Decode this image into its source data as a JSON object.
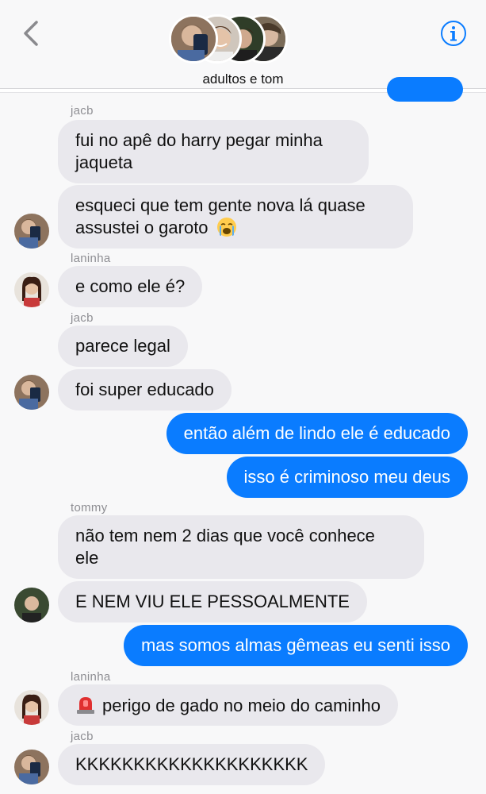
{
  "header": {
    "group_name": "adultos e tom",
    "back_icon": "chevron-left-icon",
    "info_icon": "info-icon",
    "accent": "#0a7cff"
  },
  "colors": {
    "incoming_bubble": "#e9e8ed",
    "outgoing_bubble": "#0a7cff",
    "sender_label": "#8e8e93"
  },
  "messages": [
    {
      "sender": "jacb",
      "text": "fui no apê do harry pegar minha",
      "text2": "jaqueta"
    },
    {
      "text": "esqueci que tem gente nova lá quase",
      "text2": "assustei o garoto",
      "emoji": "loudly-crying-face-icon"
    },
    {
      "sender": "laninha",
      "text": "e como ele é?"
    },
    {
      "sender": "jacb",
      "text": "parece legal"
    },
    {
      "text": "foi super educado"
    },
    {
      "text": "então além de lindo ele é educado"
    },
    {
      "text": "isso é criminoso meu deus"
    },
    {
      "sender": "tommy",
      "text": "não tem nem 2 dias que você conhece",
      "text2": "ele"
    },
    {
      "text": "E NEM VIU ELE PESSOALMENTE"
    },
    {
      "text": "mas somos almas gêmeas eu senti isso"
    },
    {
      "sender": "laninha",
      "text": "perigo de gado no meio do caminho",
      "emoji": "police-siren-icon"
    },
    {
      "sender": "jacb",
      "text": "KKKKKKKKKKKKKKKKKKKK"
    }
  ]
}
